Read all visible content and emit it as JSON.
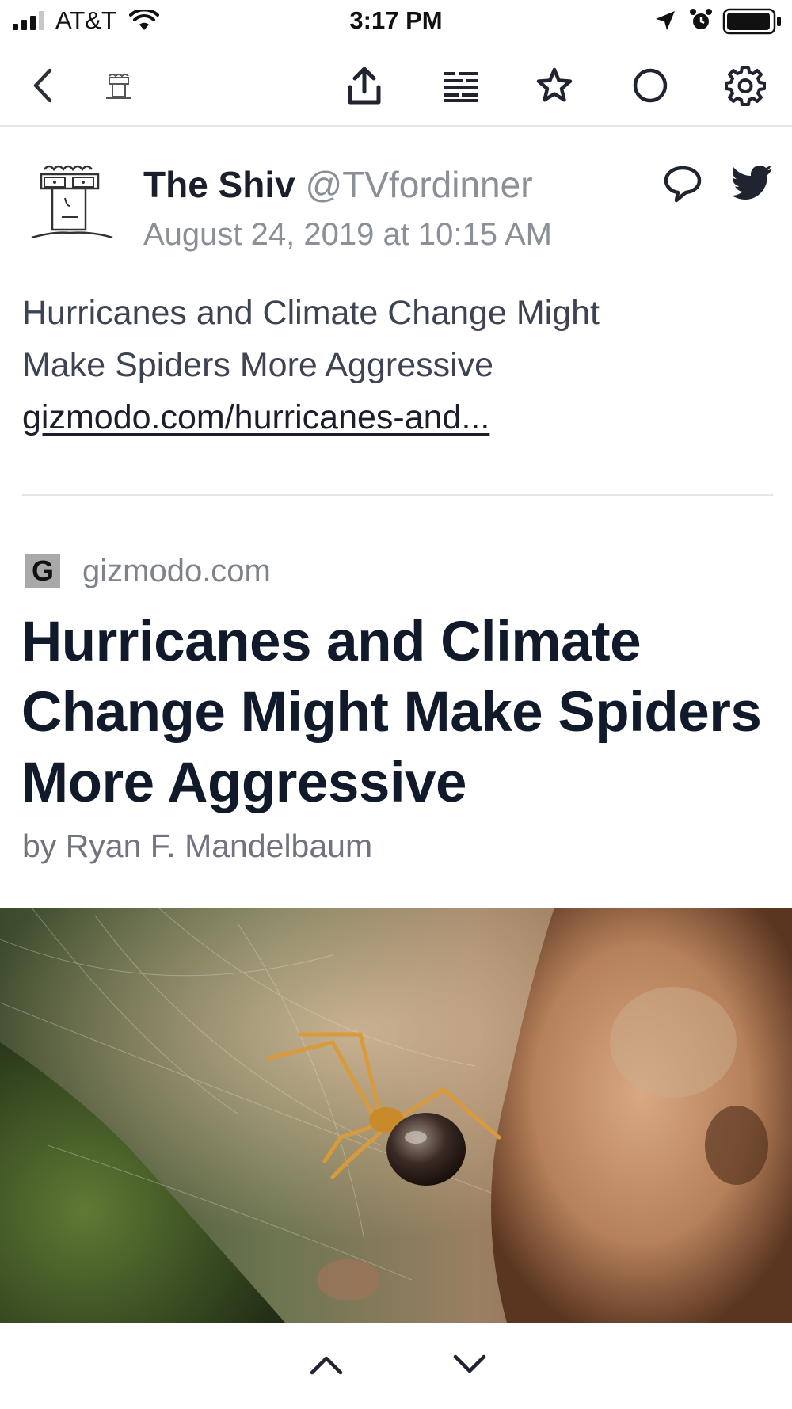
{
  "status_bar": {
    "carrier": "AT&T",
    "time": "3:17 PM"
  },
  "toolbar": {
    "icons": [
      "back-chevron-icon",
      "site-avatar-icon",
      "share-icon",
      "reader-view-icon",
      "star-icon",
      "circle-icon",
      "settings-icon"
    ]
  },
  "tweet": {
    "author_name": "The Shiv",
    "author_handle": "@TVfordinner",
    "date": "August 24, 2019 at 10:15 AM",
    "text_line_1": "Hurricanes and Climate Change Might",
    "text_line_2": "Make Spiders More Aggressive",
    "link": "gizmodo.com/hurricanes-and..."
  },
  "article": {
    "favicon_letter": "G",
    "domain": "gizmodo.com",
    "title": "Hurricanes and Climate Change Might Make Spiders More Aggressive",
    "byline": "by Ryan F. Mandelbaum"
  },
  "colors": {
    "text_primary": "#111a2b",
    "text_secondary": "#8a8f98",
    "divider": "#e4e6ea"
  }
}
